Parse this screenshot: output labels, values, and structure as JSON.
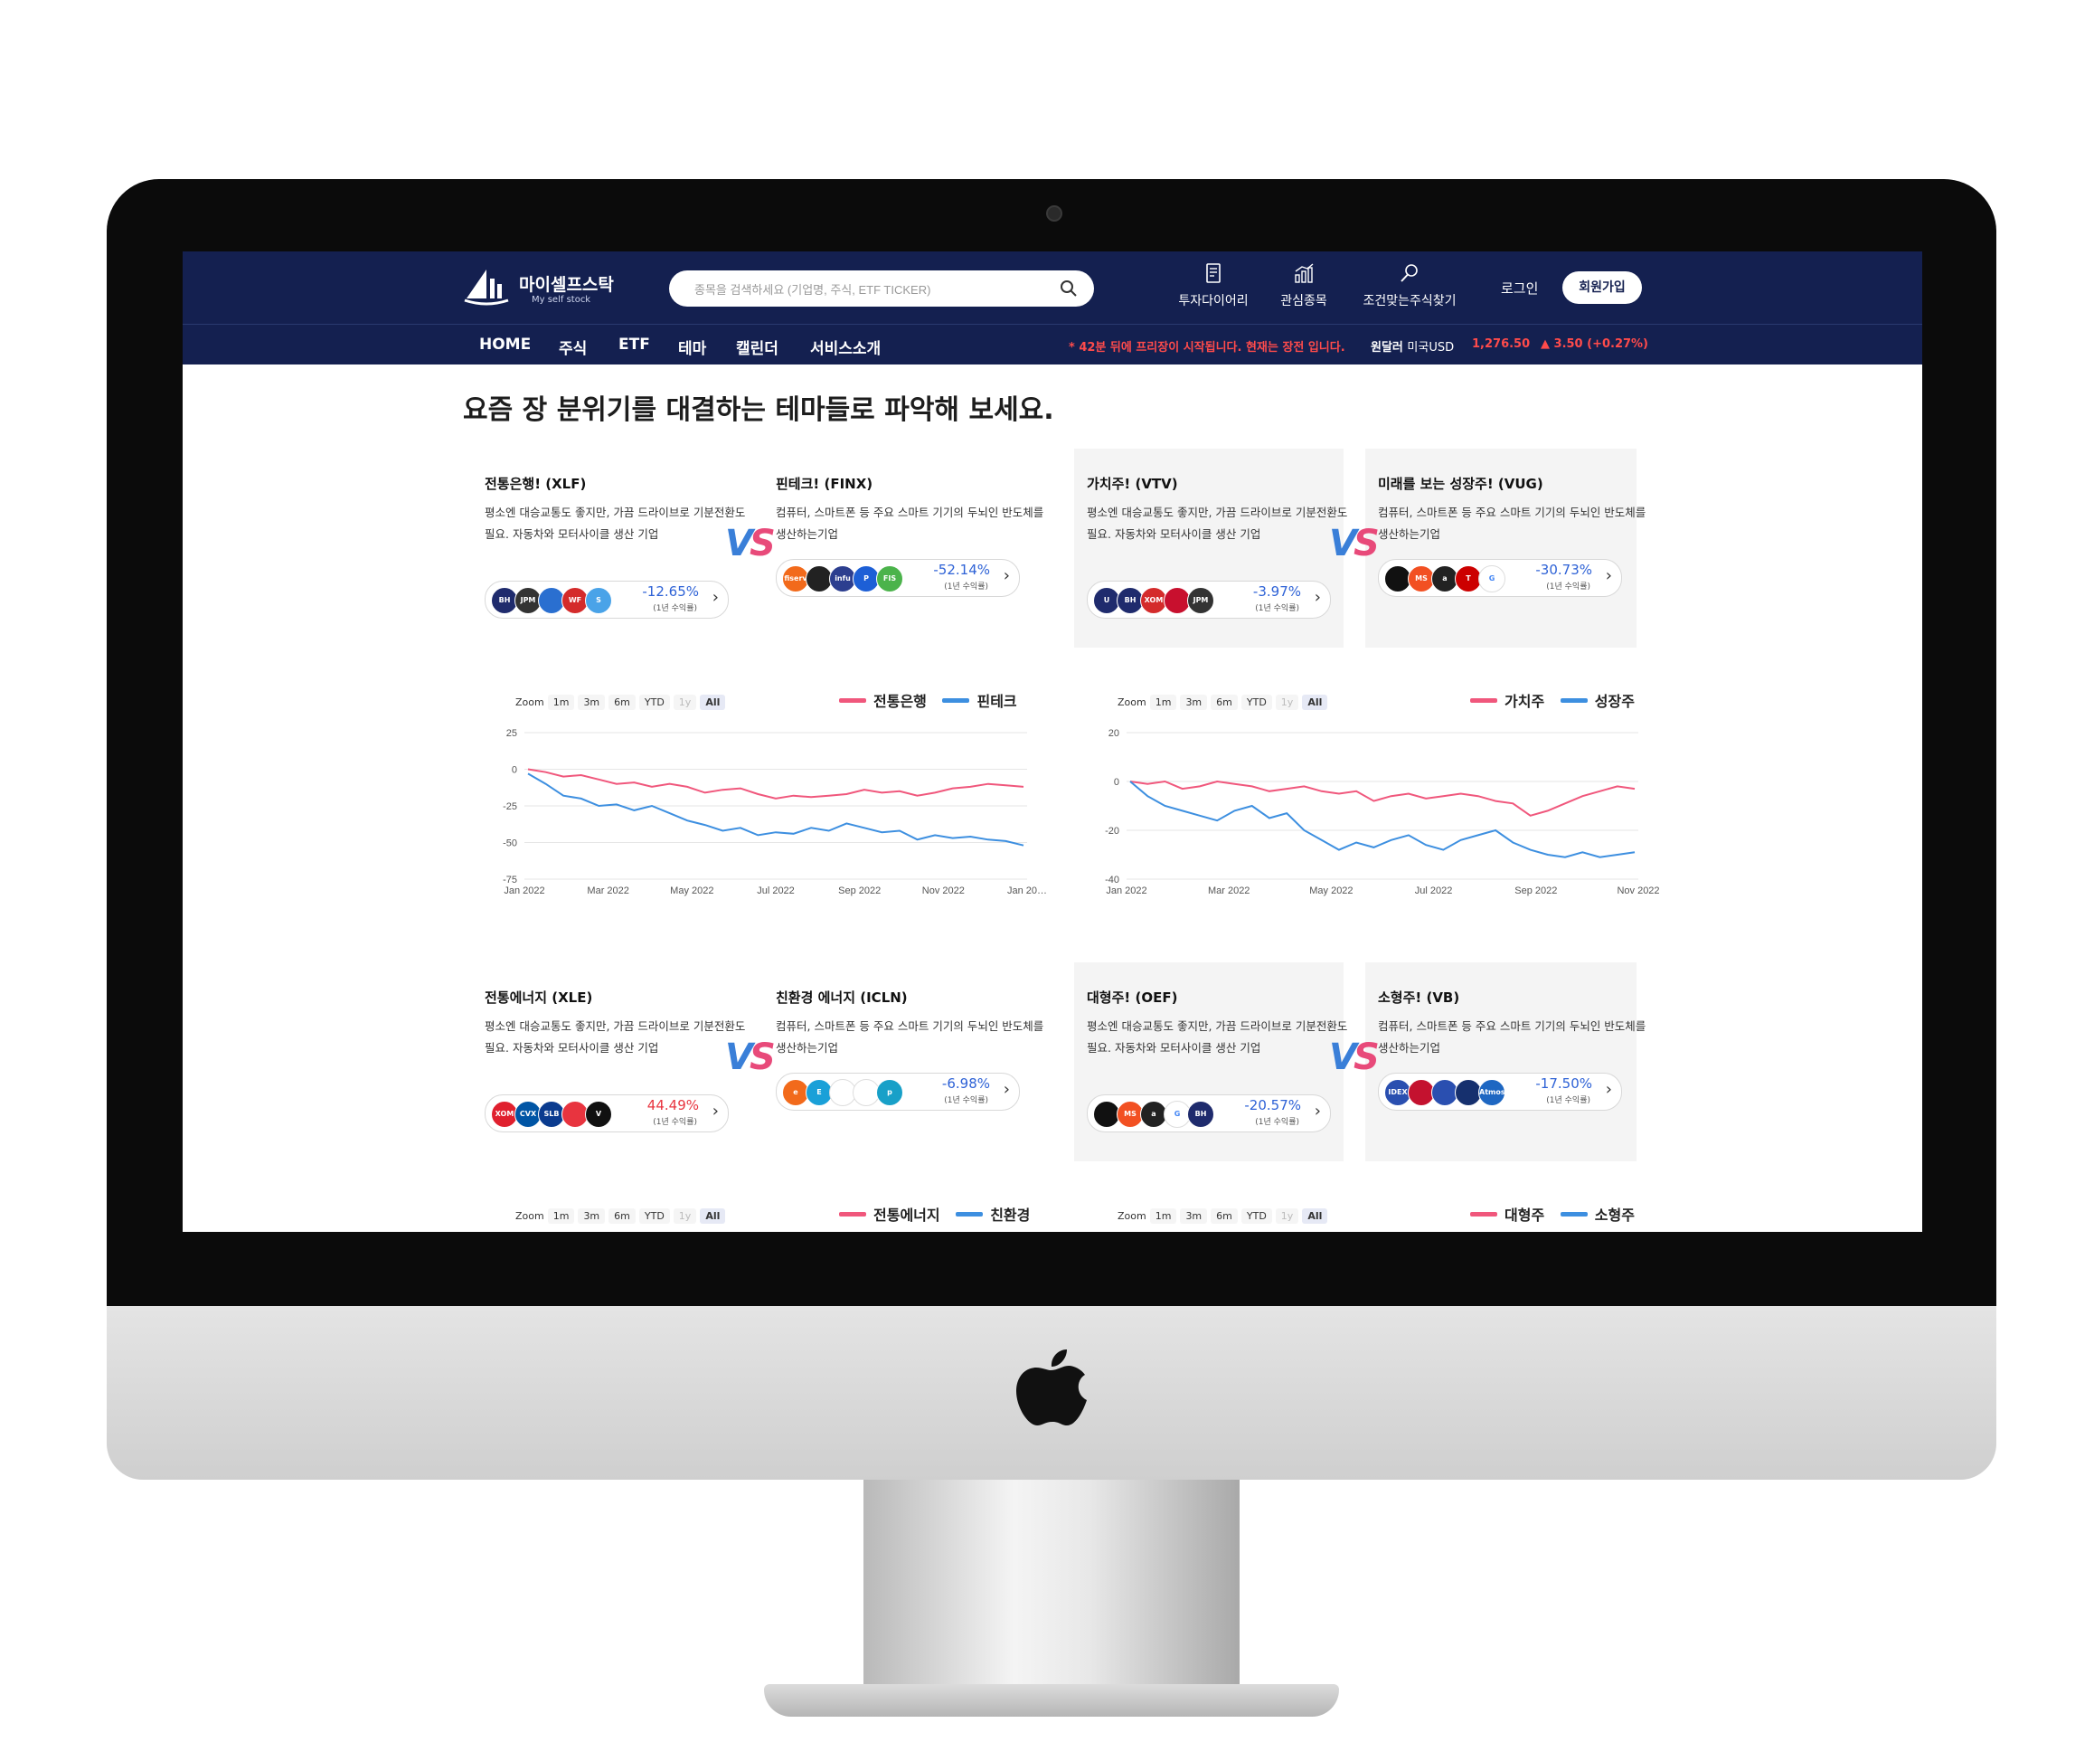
{
  "header": {
    "logo_ko": "마이셀프스탁",
    "logo_en": "My self stock",
    "search_placeholder": "종목을 검색하세요 (기업명, 주식, ETF TICKER)",
    "menu": [
      "투자다이어리",
      "관심종목",
      "조건맞는주식찾기"
    ],
    "login": "로그인",
    "signup": "회원가입"
  },
  "nav": {
    "items": [
      "HOME",
      "주식",
      "ETF",
      "테마",
      "캘린더",
      "서비스소개"
    ],
    "notice": "* 42분 뒤에 프리장이 시작됩니다. 현재는 장전 입니다.",
    "fx_label": "원달러",
    "fx_sub": "미국USD",
    "fx_value": "1,276.50",
    "fx_change": "▲ 3.50 (+0.27%)"
  },
  "headline": "요즘 장 분위기를 대결하는 테마들로 파악해 보세요.",
  "cards": [
    {
      "title": "전통은행! (XLF)",
      "desc": "평소엔 대승교통도 좋지만, 가끔 드라이브로 기분전환도 필요. 자동차와 모터사이클 생산 기업",
      "ret": "-12.65%",
      "ret_sub": "(1년 수익률)",
      "logos": [
        "BH",
        "JPM",
        "",
        "WF",
        "S"
      ]
    },
    {
      "title": "핀테크! (FINX)",
      "desc": "컴퓨터, 스마트폰 등 주요 스마트 기기의 두뇌인 반도체를 생산하는기업",
      "ret": "-52.14%",
      "ret_sub": "(1년 수익률)",
      "logos": [
        "fiserv",
        "",
        "infu",
        "P",
        "FIS"
      ]
    },
    {
      "title": "가치주! (VTV)",
      "desc": "평소엔 대승교통도 좋지만, 가끔 드라이브로 기분전환도 필요. 자동차와 모터사이클 생산 기업",
      "ret": "-3.97%",
      "ret_sub": "(1년 수익률)",
      "logos": [
        "U",
        "BH",
        "XOM",
        "",
        "JPM"
      ]
    },
    {
      "title": "미래를 보는 성장주! (VUG)",
      "desc": "컴퓨터, 스마트폰 등 주요 스마트 기기의 두뇌인 반도체를 생산하는기업",
      "ret": "-30.73%",
      "ret_sub": "(1년 수익률)",
      "logos": [
        "",
        "MS",
        "a",
        "T",
        "G"
      ]
    },
    {
      "title": "전통에너지 (XLE)",
      "desc": "평소엔 대승교통도 좋지만, 가끔 드라이브로 기분전환도 필요. 자동차와 모터사이클 생산 기업",
      "ret": "44.49%",
      "ret_sub": "(1년 수익률)",
      "logos": [
        "XOM",
        "CVX",
        "SLB",
        "",
        "V"
      ]
    },
    {
      "title": "친환경 에너지 (ICLN)",
      "desc": "컴퓨터, 스마트폰 등 주요 스마트 기기의 두뇌인 반도체를 생산하는기업",
      "ret": "-6.98%",
      "ret_sub": "(1년 수익률)",
      "logos": [
        "e",
        "E",
        "",
        "",
        "p"
      ]
    },
    {
      "title": "대형주! (OEF)",
      "desc": "평소엔 대승교통도 좋지만, 가끔 드라이브로 기분전환도 필요. 자동차와 모터사이클 생산 기업",
      "ret": "-20.57%",
      "ret_sub": "(1년 수익률)",
      "logos": [
        "",
        "MS",
        "a",
        "G",
        "BH"
      ]
    },
    {
      "title": "소형주! (VB)",
      "desc": "컴퓨터, 스마트폰 등 주요 스마트 기기의 두뇌인 반도체를 생산하는기업",
      "ret": "-17.50%",
      "ret_sub": "(1년 수익률)",
      "logos": [
        "IDEX",
        "",
        "",
        "",
        "Atmos"
      ]
    }
  ],
  "zoom": {
    "label": "Zoom",
    "buttons": [
      "1m",
      "3m",
      "6m",
      "YTD",
      "1y",
      "All"
    ]
  },
  "colors": {
    "navy": "#142050",
    "pink": "#f0577c",
    "blue": "#3d8fe0",
    "vs_blue": "#3a7fd8",
    "vs_pink": "#e84a7a"
  },
  "chart_data": [
    {
      "type": "line",
      "legend": [
        "전통은행",
        "핀테크"
      ],
      "ylim": [
        -75,
        25
      ],
      "yticks": [
        25,
        0,
        -25,
        -50,
        -75
      ],
      "xticks": [
        "Jan 2022",
        "Mar 2022",
        "May 2022",
        "Jul 2022",
        "Sep 2022",
        "Nov 2022",
        "Jan 20…"
      ],
      "series": [
        {
          "name": "전통은행",
          "values": [
            0,
            -2,
            -5,
            -4,
            -7,
            -10,
            -9,
            -12,
            -10,
            -12,
            -16,
            -14,
            -13,
            -17,
            -20,
            -18,
            -19,
            -18,
            -17,
            -14,
            -16,
            -15,
            -18,
            -16,
            -13,
            -12,
            -10,
            -11,
            -12
          ]
        },
        {
          "name": "핀테크",
          "values": [
            -3,
            -10,
            -18,
            -20,
            -25,
            -24,
            -28,
            -25,
            -30,
            -35,
            -38,
            -42,
            -40,
            -45,
            -43,
            -44,
            -40,
            -42,
            -37,
            -40,
            -43,
            -42,
            -48,
            -45,
            -47,
            -46,
            -48,
            -49,
            -52
          ]
        }
      ]
    },
    {
      "type": "line",
      "legend": [
        "가치주",
        "성장주"
      ],
      "ylim": [
        -40,
        20
      ],
      "yticks": [
        20,
        0,
        -20,
        -40
      ],
      "xticks": [
        "Jan 2022",
        "Mar 2022",
        "May 2022",
        "Jul 2022",
        "Sep 2022",
        "Nov 2022"
      ],
      "series": [
        {
          "name": "가치주",
          "values": [
            0,
            -1,
            0,
            -3,
            -2,
            0,
            -1,
            -2,
            -4,
            -3,
            -2,
            -4,
            -5,
            -4,
            -8,
            -6,
            -5,
            -7,
            -6,
            -5,
            -6,
            -8,
            -9,
            -14,
            -12,
            -9,
            -6,
            -4,
            -2,
            -3
          ]
        },
        {
          "name": "성장주",
          "values": [
            0,
            -6,
            -10,
            -12,
            -14,
            -16,
            -12,
            -10,
            -15,
            -13,
            -20,
            -24,
            -28,
            -25,
            -27,
            -24,
            -22,
            -26,
            -28,
            -24,
            -22,
            -20,
            -25,
            -28,
            -30,
            -31,
            -29,
            -31,
            -30,
            -29
          ]
        }
      ]
    },
    {
      "type": "line",
      "legend": [
        "전통에너지",
        "친환경"
      ],
      "series": []
    },
    {
      "type": "line",
      "legend": [
        "대형주",
        "소형주"
      ],
      "series": []
    }
  ]
}
